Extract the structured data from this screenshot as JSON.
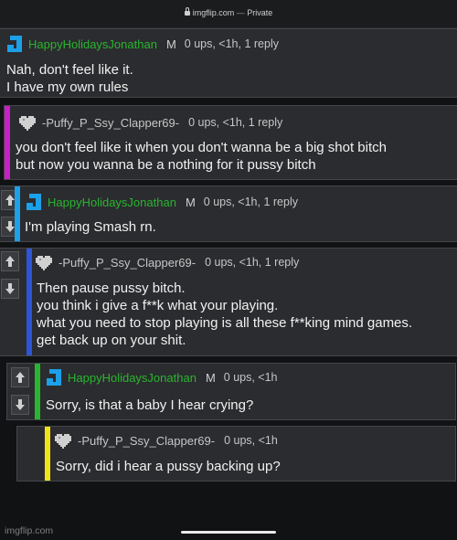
{
  "browser": {
    "url": "imgflip.com",
    "separator": "—",
    "privacy": "Private"
  },
  "colors": {
    "green": "#29b52f",
    "magenta": "#c81fc8",
    "blue": "#2c55d8",
    "cyan": "#1ca0e8",
    "yellow": "#f2e218"
  },
  "comments": [
    {
      "username": "HappyHolidaysJonathan",
      "mod_badge": "M",
      "meta": "0 ups, <1h, 1 reply",
      "lines": [
        "Nah, don't feel like it.",
        "I have my own rules"
      ],
      "avatar": "blue-j-icon"
    },
    {
      "username": "-Puffy_P_Ssy_Clapper69-",
      "meta": "0 ups, <1h, 1 reply",
      "lines": [
        "you don't feel like it when you don't wanna be a big shot bitch",
        "but now you wanna be a nothing for it pussy bitch"
      ],
      "avatar": "pixel-heart-icon"
    },
    {
      "username": "HappyHolidaysJonathan",
      "mod_badge": "M",
      "meta": "0 ups, <1h, 1 reply",
      "lines": [
        "I'm playing Smash rn."
      ],
      "avatar": "blue-j-icon"
    },
    {
      "username": "-Puffy_P_Ssy_Clapper69-",
      "meta": "0 ups, <1h, 1 reply",
      "lines": [
        "Then pause pussy bitch.",
        "you think i give a f**k what your playing.",
        "what you need to stop playing is all these f**king mind games.",
        "get back up on your shit."
      ],
      "avatar": "pixel-heart-icon"
    },
    {
      "username": "HappyHolidaysJonathan",
      "mod_badge": "M",
      "meta": "0 ups, <1h",
      "lines": [
        "Sorry, is that a baby I hear crying?"
      ],
      "avatar": "blue-j-icon"
    },
    {
      "username": "-Puffy_P_Ssy_Clapper69-",
      "meta": "0 ups, <1h",
      "lines": [
        "Sorry, did i hear a pussy backing up?"
      ],
      "avatar": "pixel-heart-icon"
    }
  ],
  "footer": {
    "watermark": "imgflip.com"
  }
}
